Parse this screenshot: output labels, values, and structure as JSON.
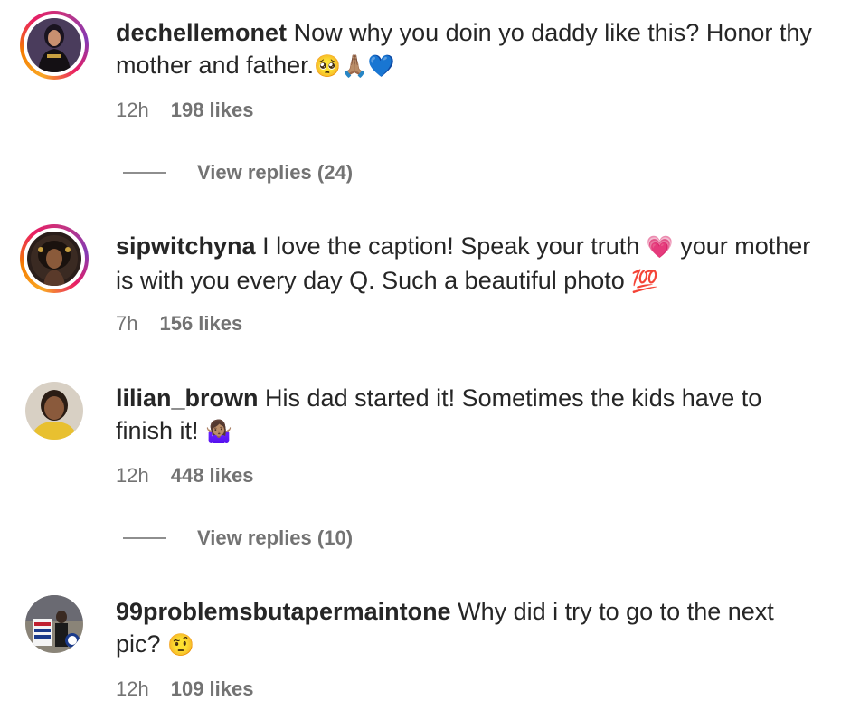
{
  "comments": [
    {
      "username": "dechellemonet",
      "text": "Now why you doin yo daddy like this? Honor thy mother and father.",
      "emoji": "🥺🙏🏽💙",
      "time": "12h",
      "likes": "198 likes",
      "replies": "View replies (24)",
      "avatar_icon": "user-photo-avatar",
      "has_story_ring": true
    },
    {
      "username": "sipwitchyna",
      "text_part1": "I love the caption! Speak your truth ",
      "emoji1": "💗",
      "text_part2": " your mother is with you every day Q. Such a beautiful photo ",
      "emoji2": "💯",
      "time": "7h",
      "likes": "156 likes",
      "avatar_icon": "illustrated-avatar",
      "has_story_ring": true
    },
    {
      "username": "lilian_brown",
      "text": "His dad started it! Sometimes the kids have to finish it! ",
      "emoji": "🤷🏽‍♀️",
      "time": "12h",
      "likes": "448 likes",
      "replies": "View replies (10)",
      "avatar_icon": "user-photo-avatar",
      "has_story_ring": false
    },
    {
      "username": "99problemsbutapermaintone",
      "text": "Why did i try to go to the next pic? ",
      "emoji": "🤨",
      "time": "12h",
      "likes": "109 likes",
      "avatar_icon": "early-voting-photo-avatar",
      "has_story_ring": false
    }
  ],
  "colors": {
    "text": "#262626",
    "secondary": "#737373",
    "ring_gradient": [
      "#f9a825",
      "#e91e63",
      "#833ab4"
    ]
  }
}
